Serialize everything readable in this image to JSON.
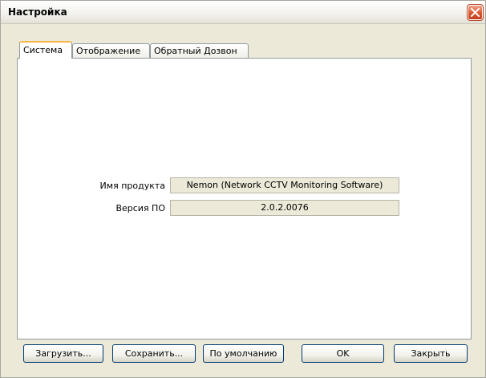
{
  "window": {
    "title": "Настройка"
  },
  "tabs": [
    {
      "label": "Система",
      "active": true
    },
    {
      "label": "Отображение",
      "active": false
    },
    {
      "label": "Обратный Дозвон",
      "active": false
    }
  ],
  "system": {
    "product_label": "Имя продукта",
    "product_value": "Nemon (Network CCTV Monitoring Software)",
    "version_label": "Версия ПО",
    "version_value": "2.0.2.0076"
  },
  "buttons": {
    "load": "Загрузить...",
    "save": "Сохранить...",
    "default": "По умолчанию",
    "ok": "OK",
    "close": "Закрыть"
  },
  "colors": {
    "background": "#ece9d8",
    "button_border": "#003c74",
    "active_tab_accent": "#f7b646",
    "close_button": "#d9572f"
  },
  "icons": {
    "close": "close-icon"
  }
}
